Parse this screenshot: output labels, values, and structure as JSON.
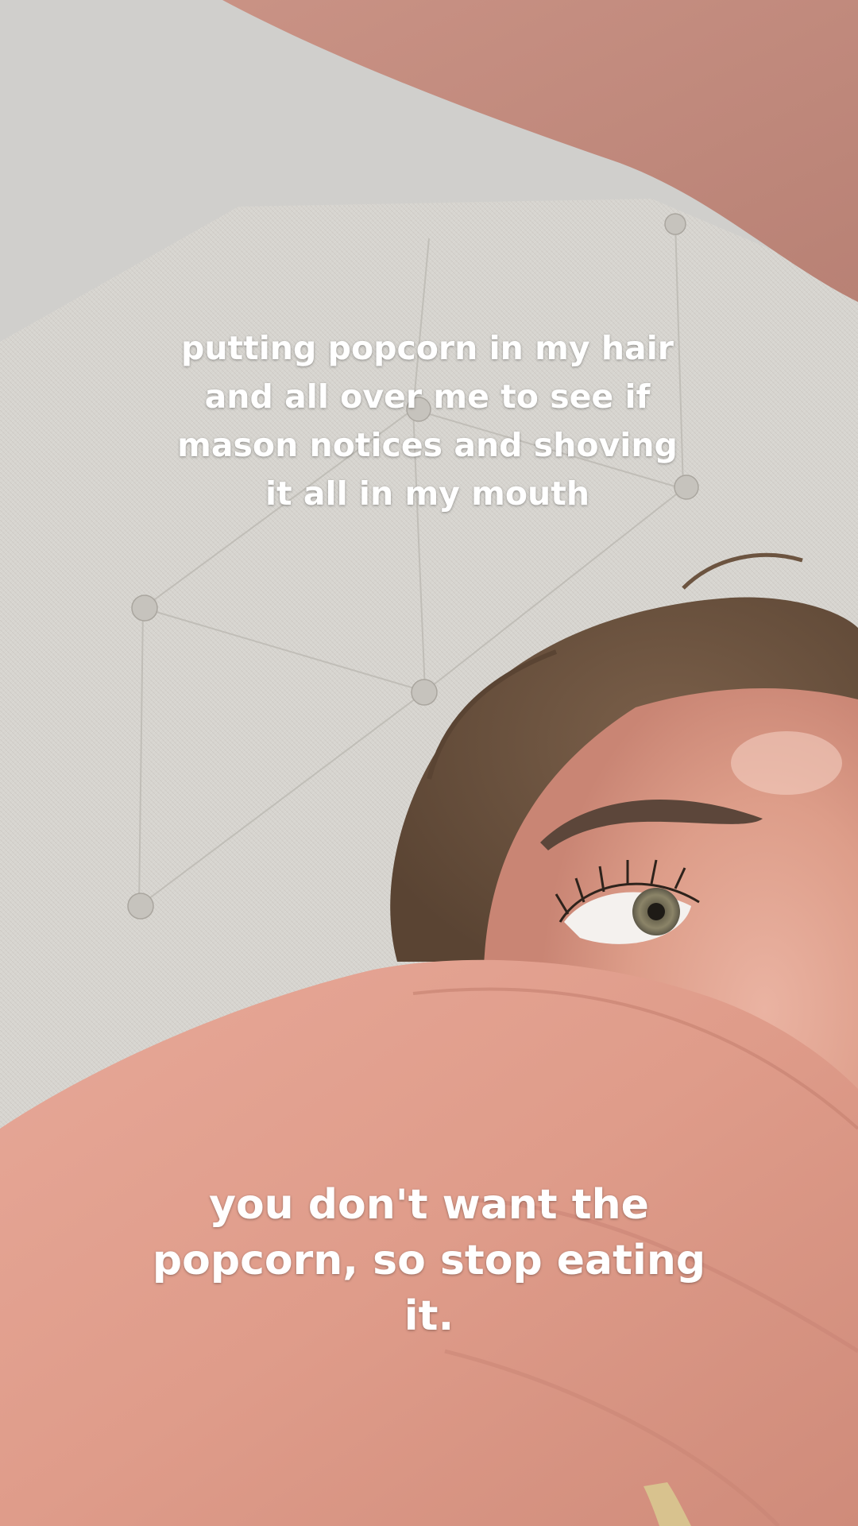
{
  "captions": {
    "top": "putting popcorn in my hair and all over me to see if mason notices and shoving it all in my mouth",
    "bottom": "you don't want the popcorn, so stop eating it."
  },
  "colors": {
    "headboard": "#d6d4cf",
    "skin": "#e0a291",
    "hair": "#6e5441",
    "caption_text": "#ffffff"
  }
}
